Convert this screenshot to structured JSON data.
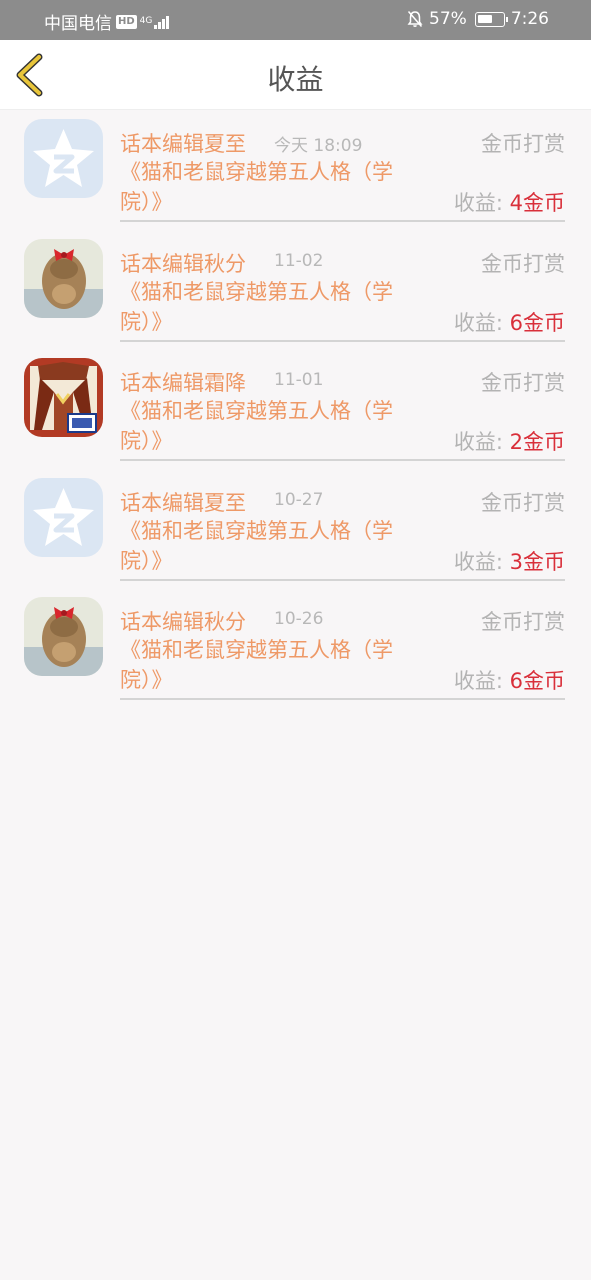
{
  "status_bar": {
    "carrier": "中国电信",
    "hd": "HD",
    "network": "4G",
    "battery": "57%",
    "time": "7:26"
  },
  "header": {
    "title": "收益"
  },
  "items": [
    {
      "editor": "话本编辑夏至",
      "time": "今天 18:09",
      "type": "金币打赏",
      "story": "《猫和老鼠穿越第五人格（学院）》",
      "earn_label": "收益:",
      "earn_value": "4金币",
      "avatar": "qq-star-icon"
    },
    {
      "editor": "话本编辑秋分",
      "time": "11-02",
      "type": "金币打赏",
      "story": "《猫和老鼠穿越第五人格（学院）》",
      "earn_label": "收益:",
      "earn_value": "6金币",
      "avatar": "hair-bow-photo"
    },
    {
      "editor": "话本编辑霜降",
      "time": "11-01",
      "type": "金币打赏",
      "story": "《猫和老鼠穿越第五人格（学院）》",
      "earn_label": "收益:",
      "earn_value": "2金币",
      "avatar": "anime-character-image"
    },
    {
      "editor": "话本编辑夏至",
      "time": "10-27",
      "type": "金币打赏",
      "story": "《猫和老鼠穿越第五人格（学院）》",
      "earn_label": "收益:",
      "earn_value": "3金币",
      "avatar": "qq-star-icon"
    },
    {
      "editor": "话本编辑秋分",
      "time": "10-26",
      "type": "金币打赏",
      "story": "《猫和老鼠穿越第五人格（学院）》",
      "earn_label": "收益:",
      "earn_value": "6金币",
      "avatar": "hair-bow-photo"
    }
  ],
  "colors": {
    "accent": "#ee9967",
    "earn": "#d92f3a",
    "back_icon": "#e8c53a",
    "status_bar": "#8c8c8c"
  }
}
